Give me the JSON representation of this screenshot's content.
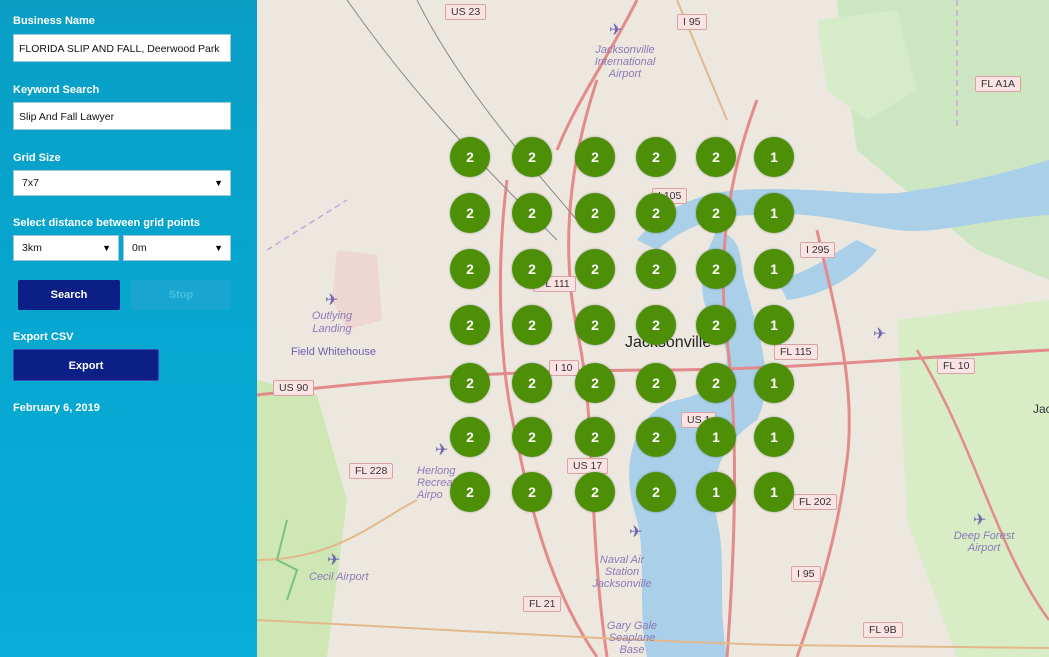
{
  "sidebar": {
    "business_label": "Business Name",
    "business_value": "FLORIDA SLIP AND FALL, Deerwood Park",
    "keyword_label": "Keyword Search",
    "keyword_value": "Slip And Fall Lawyer",
    "grid_label": "Grid Size",
    "grid_value": "7x7",
    "distance_label": "Select distance between grid points",
    "distance_value": "3km",
    "offset_value": "0m",
    "search_label": "Search",
    "stop_label": "Stop",
    "export_heading": "Export CSV",
    "export_label": "Export",
    "date": "February 6, 2019"
  },
  "grid": [
    [
      "2",
      "2",
      "2",
      "2",
      "2",
      "1"
    ],
    [
      "2",
      "2",
      "2",
      "2",
      "2",
      "1"
    ],
    [
      "2",
      "2",
      "2",
      "2",
      "2",
      "1"
    ],
    [
      "2",
      "2",
      "2",
      "2",
      "2",
      "1"
    ],
    [
      "2",
      "2",
      "2",
      "2",
      "2",
      "1"
    ],
    [
      "2",
      "2",
      "2",
      "2",
      "1",
      "1"
    ],
    [
      "2",
      "2",
      "2",
      "2",
      "1",
      "1"
    ]
  ],
  "map_labels": {
    "city": "Jacksonville",
    "airport_intl": "Jacksonville International Airport",
    "outlying": "Outlying Landing",
    "field_whitehouse": "Field Whitehouse",
    "herlong": "Herlong Recreat... Airpo",
    "cecil": "Cecil Airport",
    "nas": "Naval Air Station Jacksonville",
    "gary_gale": "Gary Gale Seaplane Base",
    "deep_forest": "Deep Forest Airport",
    "jac": "Jac"
  },
  "road_shields": {
    "us23": "US 23",
    "i95_top": "I 95",
    "fla1a": "FL A1A",
    "i105": "I 105",
    "i295": "I 295",
    "fl111": "FL 111",
    "fl115": "FL 115",
    "fl10": "FL 10",
    "us90": "US 90",
    "i10": "I 10",
    "us1": "US 1",
    "fl228": "FL 228",
    "us17": "US 17",
    "fl202": "FL 202",
    "i95_bot": "I 95",
    "fl21": "FL 21",
    "fl9b": "FL 9B"
  }
}
